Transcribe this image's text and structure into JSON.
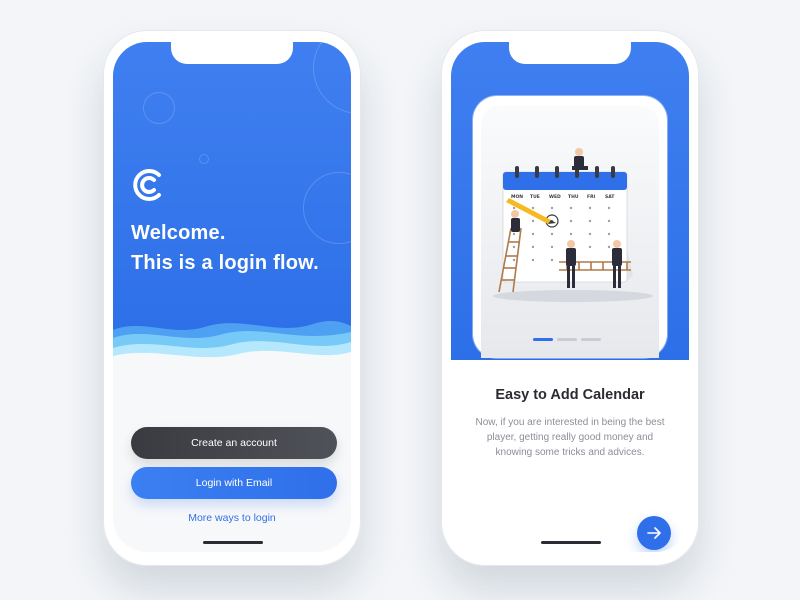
{
  "login_screen": {
    "heading_line1": "Welcome.",
    "heading_line2": "This is a login flow.",
    "create_account_label": "Create an account",
    "login_email_label": "Login with Email",
    "more_ways_label": "More ways to login",
    "logo_icon": "c-logo-icon"
  },
  "onboarding_screen": {
    "title": "Easy to Add Calendar",
    "description": "Now, if you are interested in being the best player, getting really good money and knowing some tricks and advices.",
    "calendar_days": [
      "MON",
      "TUE",
      "WED",
      "THU",
      "FRI",
      "SAT"
    ],
    "carousel": {
      "count": 3,
      "active_index": 0
    },
    "next_icon": "arrow-right-icon"
  },
  "colors": {
    "primary": "#2f6fe9",
    "dark_button": "#3a3b40",
    "background": "#f3f5f8",
    "title_text": "#2b2b33",
    "body_text": "#8b8f99"
  }
}
